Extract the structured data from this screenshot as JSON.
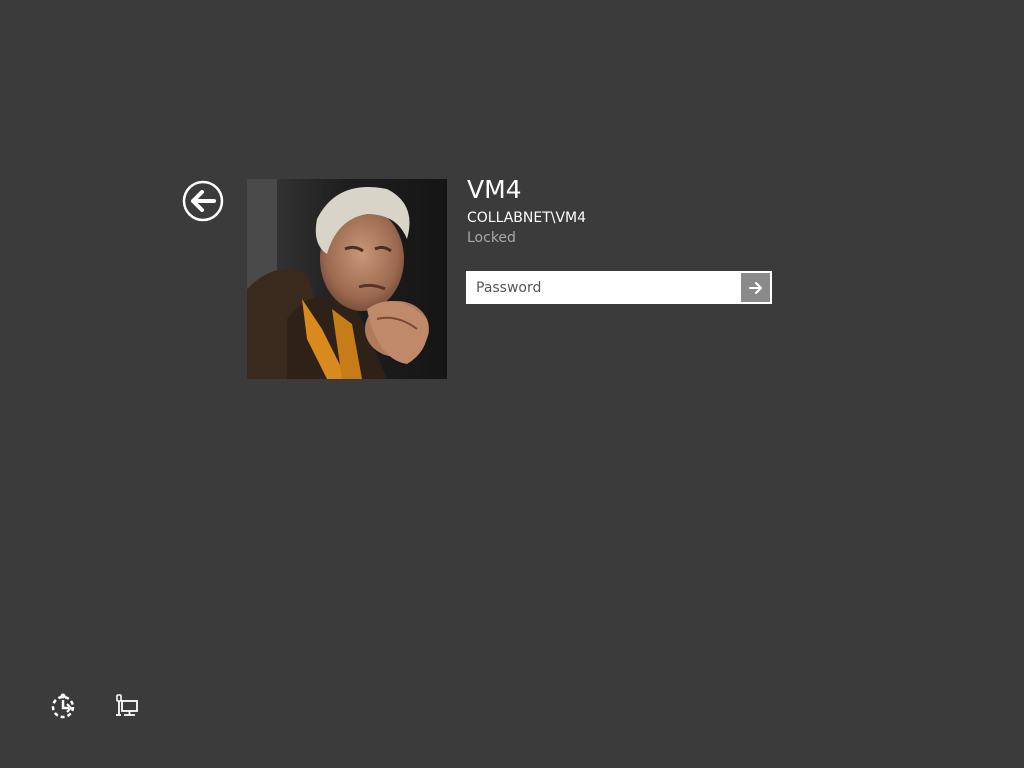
{
  "user": {
    "name": "VM4",
    "domain": "COLLABNET\\VM4",
    "status": "Locked"
  },
  "password": {
    "value": "",
    "placeholder": "Password"
  },
  "icons": {
    "back": "back-arrow-icon",
    "submit": "submit-arrow-icon",
    "ease_of_access": "ease-of-access-icon",
    "network": "network-icon"
  },
  "colors": {
    "background": "#3b3b3b",
    "text_primary": "#ffffff",
    "text_secondary": "#a8a8a8",
    "submit_button": "#8a8a8a"
  }
}
